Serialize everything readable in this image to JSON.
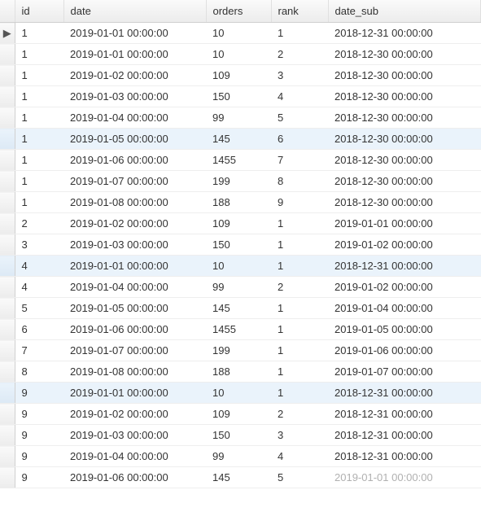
{
  "columns": {
    "id": "id",
    "date": "date",
    "orders": "orders",
    "rank": "rank",
    "date_sub": "date_sub"
  },
  "current_row_indicator": "▶",
  "rows": [
    {
      "id": "1",
      "date": "2019-01-01 00:00:00",
      "orders": "10",
      "rank": "1",
      "date_sub": "2018-12-31 00:00:00",
      "highlight": false,
      "current": true
    },
    {
      "id": "1",
      "date": "2019-01-01 00:00:00",
      "orders": "10",
      "rank": "2",
      "date_sub": "2018-12-30 00:00:00",
      "highlight": false,
      "current": false
    },
    {
      "id": "1",
      "date": "2019-01-02 00:00:00",
      "orders": "109",
      "rank": "3",
      "date_sub": "2018-12-30 00:00:00",
      "highlight": false,
      "current": false
    },
    {
      "id": "1",
      "date": "2019-01-03 00:00:00",
      "orders": "150",
      "rank": "4",
      "date_sub": "2018-12-30 00:00:00",
      "highlight": false,
      "current": false
    },
    {
      "id": "1",
      "date": "2019-01-04 00:00:00",
      "orders": "99",
      "rank": "5",
      "date_sub": "2018-12-30 00:00:00",
      "highlight": false,
      "current": false
    },
    {
      "id": "1",
      "date": "2019-01-05 00:00:00",
      "orders": "145",
      "rank": "6",
      "date_sub": "2018-12-30 00:00:00",
      "highlight": true,
      "current": false
    },
    {
      "id": "1",
      "date": "2019-01-06 00:00:00",
      "orders": "1455",
      "rank": "7",
      "date_sub": "2018-12-30 00:00:00",
      "highlight": false,
      "current": false
    },
    {
      "id": "1",
      "date": "2019-01-07 00:00:00",
      "orders": "199",
      "rank": "8",
      "date_sub": "2018-12-30 00:00:00",
      "highlight": false,
      "current": false
    },
    {
      "id": "1",
      "date": "2019-01-08 00:00:00",
      "orders": "188",
      "rank": "9",
      "date_sub": "2018-12-30 00:00:00",
      "highlight": false,
      "current": false
    },
    {
      "id": "2",
      "date": "2019-01-02 00:00:00",
      "orders": "109",
      "rank": "1",
      "date_sub": "2019-01-01 00:00:00",
      "highlight": false,
      "current": false
    },
    {
      "id": "3",
      "date": "2019-01-03 00:00:00",
      "orders": "150",
      "rank": "1",
      "date_sub": "2019-01-02 00:00:00",
      "highlight": false,
      "current": false
    },
    {
      "id": "4",
      "date": "2019-01-01 00:00:00",
      "orders": "10",
      "rank": "1",
      "date_sub": "2018-12-31 00:00:00",
      "highlight": true,
      "current": false
    },
    {
      "id": "4",
      "date": "2019-01-04 00:00:00",
      "orders": "99",
      "rank": "2",
      "date_sub": "2019-01-02 00:00:00",
      "highlight": false,
      "current": false
    },
    {
      "id": "5",
      "date": "2019-01-05 00:00:00",
      "orders": "145",
      "rank": "1",
      "date_sub": "2019-01-04 00:00:00",
      "highlight": false,
      "current": false
    },
    {
      "id": "6",
      "date": "2019-01-06 00:00:00",
      "orders": "1455",
      "rank": "1",
      "date_sub": "2019-01-05 00:00:00",
      "highlight": false,
      "current": false
    },
    {
      "id": "7",
      "date": "2019-01-07 00:00:00",
      "orders": "199",
      "rank": "1",
      "date_sub": "2019-01-06 00:00:00",
      "highlight": false,
      "current": false
    },
    {
      "id": "8",
      "date": "2019-01-08 00:00:00",
      "orders": "188",
      "rank": "1",
      "date_sub": "2019-01-07 00:00:00",
      "highlight": false,
      "current": false
    },
    {
      "id": "9",
      "date": "2019-01-01 00:00:00",
      "orders": "10",
      "rank": "1",
      "date_sub": "2018-12-31 00:00:00",
      "highlight": true,
      "current": false
    },
    {
      "id": "9",
      "date": "2019-01-02 00:00:00",
      "orders": "109",
      "rank": "2",
      "date_sub": "2018-12-31 00:00:00",
      "highlight": false,
      "current": false
    },
    {
      "id": "9",
      "date": "2019-01-03 00:00:00",
      "orders": "150",
      "rank": "3",
      "date_sub": "2018-12-31 00:00:00",
      "highlight": false,
      "current": false
    },
    {
      "id": "9",
      "date": "2019-01-04 00:00:00",
      "orders": "99",
      "rank": "4",
      "date_sub": "2018-12-31 00:00:00",
      "highlight": false,
      "current": false
    },
    {
      "id": "9",
      "date": "2019-01-06 00:00:00",
      "orders": "145",
      "rank": "5",
      "date_sub": "2019-01-01 00:00:00",
      "highlight": false,
      "current": false,
      "watermark": true
    }
  ]
}
